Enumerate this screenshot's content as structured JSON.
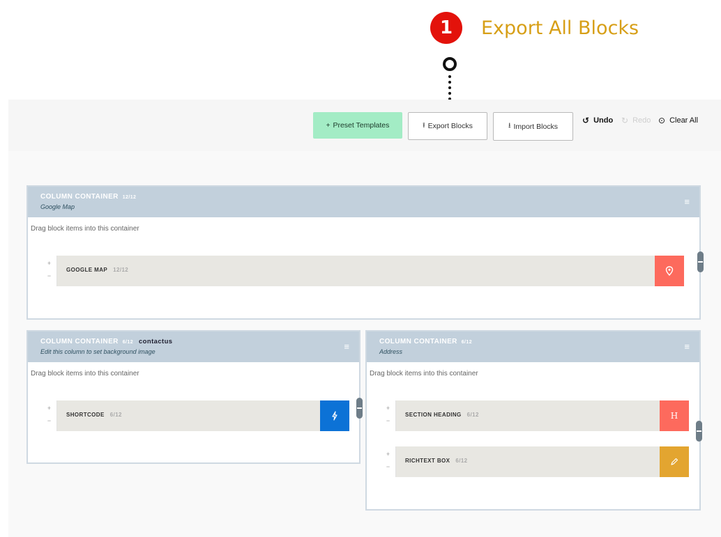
{
  "callout": {
    "number": "1",
    "text": "Export All Blocks"
  },
  "toolbar": {
    "preset_label": "Preset Templates",
    "export_label": "Export Blocks",
    "import_label": "Import Blocks",
    "undo_label": "Undo",
    "redo_label": "Redo",
    "clear_label": "Clear All"
  },
  "containers": [
    {
      "title": "COLUMN CONTAINER",
      "fraction": "12/12",
      "subtitle": "Google Map",
      "drag_hint": "Drag block items into this container",
      "blocks": [
        {
          "label": "GOOGLE MAP",
          "fraction": "12/12",
          "icon": "map-pin-icon",
          "color": "#fd6a5d"
        }
      ]
    },
    {
      "title": "COLUMN CONTAINER",
      "fraction": "6/12",
      "tag": "contactus",
      "subtitle": "Edit this column to set background image",
      "drag_hint": "Drag block items into this container",
      "blocks": [
        {
          "label": "SHORTCODE",
          "fraction": "6/12",
          "icon": "bolt-icon",
          "color": "#0c72d6"
        }
      ]
    },
    {
      "title": "COLUMN CONTAINER",
      "fraction": "6/12",
      "subtitle": "Address",
      "drag_hint": "Drag block items into this container",
      "blocks": [
        {
          "label": "SECTION HEADING",
          "fraction": "6/12",
          "icon": "heading-icon",
          "glyph": "H",
          "color": "#fd6a5d"
        },
        {
          "label": "RICHTEXT BOX",
          "fraction": "6/12",
          "icon": "pencil-icon",
          "color": "#e3a530"
        }
      ]
    }
  ]
}
